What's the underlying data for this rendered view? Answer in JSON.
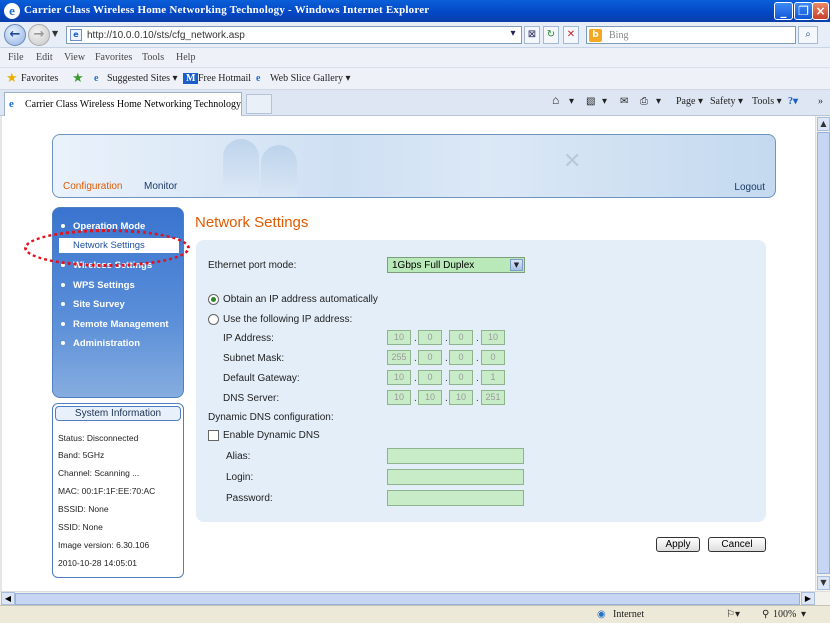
{
  "browser": {
    "window_title": "Carrier Class Wireless Home Networking Technology - Windows Internet Explorer",
    "url": "http://10.0.0.10/sts/cfg_network.asp",
    "search_placeholder": "Bing",
    "menu": [
      "File",
      "Edit",
      "View",
      "Favorites",
      "Tools",
      "Help"
    ],
    "favorites": {
      "label": "Favorites",
      "suggested": "Suggested Sites ▾",
      "hotmail": "Free Hotmail",
      "gallery": "Web Slice Gallery ▾"
    },
    "tab_title": "Carrier Class Wireless Home Networking Technology",
    "commands": {
      "page": "Page ▾",
      "safety": "Safety ▾",
      "tools": "Tools ▾"
    },
    "status": {
      "zone": "Internet",
      "zoom": "100%"
    }
  },
  "router": {
    "nav": {
      "configuration": "Configuration",
      "monitor": "Monitor",
      "logout": "Logout"
    },
    "menu_items": [
      "Operation Mode",
      "Network Settings",
      "Wireless Settings",
      "WPS Settings",
      "Site Survey",
      "Remote Management",
      "Administration"
    ],
    "system_info": {
      "title": "System Information",
      "lines": [
        "Status: Disconnected",
        "Band: 5GHz",
        "Channel: Scanning ...",
        "MAC: 00:1F:1F:EE:70:AC",
        "BSSID: None",
        "SSID: None",
        "Image version: 6.30.106",
        "2010-10-28 14:05:01"
      ]
    },
    "page_title": "Network Settings",
    "form": {
      "ethernet_port_mode_label": "Ethernet port mode:",
      "ethernet_port_mode_value": "1Gbps Full Duplex",
      "obtain_auto_label": "Obtain an IP address automatically",
      "use_following_label": "Use the following IP address:",
      "ip_label": "IP Address:",
      "ip": [
        "10",
        "0",
        "0",
        "10"
      ],
      "mask_label": "Subnet Mask:",
      "mask": [
        "255",
        "0",
        "0",
        "0"
      ],
      "gateway_label": "Default Gateway:",
      "gateway": [
        "10",
        "0",
        "0",
        "1"
      ],
      "dns_label": "DNS Server:",
      "dns": [
        "10",
        "10",
        "10",
        "251"
      ],
      "ddns_section_label": "Dynamic DNS configuration:",
      "enable_ddns_label": "Enable Dynamic DNS",
      "alias_label": "Alias:",
      "login_label": "Login:",
      "password_label": "Password:"
    },
    "apply_label": "Apply",
    "cancel_label": "Cancel"
  }
}
